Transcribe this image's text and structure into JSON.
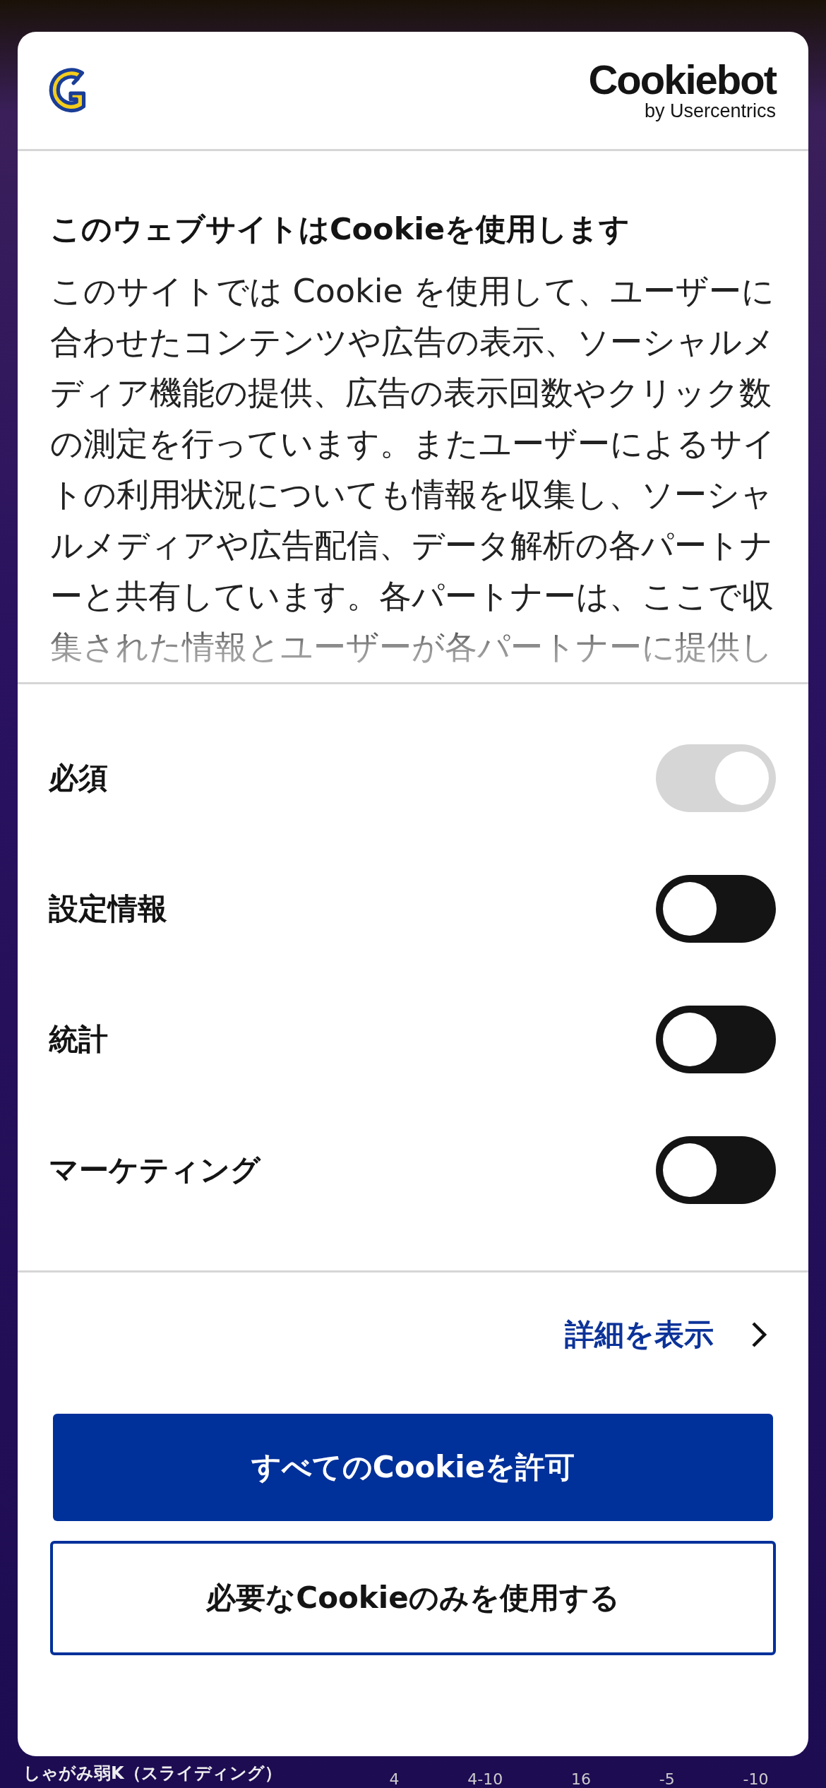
{
  "dialog": {
    "brand": {
      "name": "Cookiebot",
      "byline": "by Usercentrics"
    },
    "title": "このウェブサイトはCookieを使用します",
    "body": "このサイトでは Cookie を使用して、ユーザーに合わせたコンテンツや広告の表示、ソーシャルメディア機能の提供、広告の表示回数やクリック数の測定を行っています。またユーザーによるサイトの利用状況についても情報を収集し、ソーシャルメディアや広告配信、データ解析の各パートナーと共有しています。各パートナーは、ここで収集された情報とユーザーが各パートナーに提供し",
    "toggles": [
      {
        "label": "必須",
        "checked": true,
        "disabled": true
      },
      {
        "label": "設定情報",
        "checked": false,
        "disabled": false
      },
      {
        "label": "統計",
        "checked": false,
        "disabled": false
      },
      {
        "label": "マーケティング",
        "checked": false,
        "disabled": false
      }
    ],
    "details_link": "詳細を表示",
    "buttons": [
      {
        "label": "すべてのCookieを許可",
        "kind": "primary"
      },
      {
        "label": "必要なCookieのみを使用する",
        "kind": "outline"
      }
    ]
  },
  "background_row": {
    "label": "しゃがみ弱K（スライディング）",
    "values": [
      "4",
      "4-10",
      "16",
      "-5",
      "-10"
    ]
  }
}
